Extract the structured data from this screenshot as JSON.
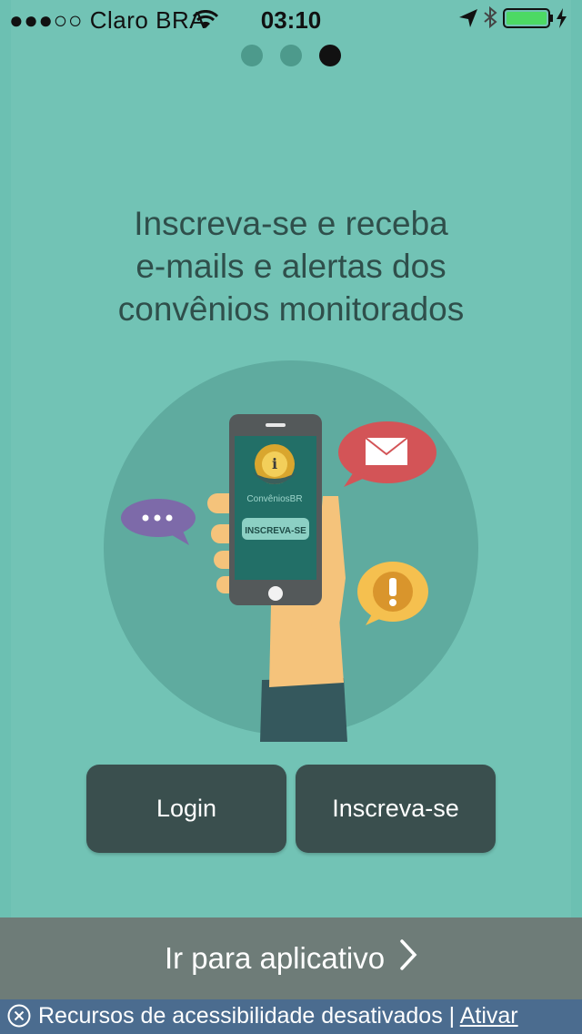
{
  "status_bar": {
    "carrier": "●●●○○ Claro BRA",
    "time": "03:10"
  },
  "pager": {
    "pages": 3,
    "current": 3
  },
  "headline": {
    "line1": "Inscreva-se e receba",
    "line2": "e-mails e alertas dos",
    "line3": "convênios monitorados"
  },
  "illustration": {
    "app_name": "ConvêniosBR",
    "phone_button": "INSCREVA-SE"
  },
  "buttons": {
    "login": "Login",
    "signup": "Inscreva-se"
  },
  "go_bar": {
    "label": "Ir para aplicativo"
  },
  "accessibility": {
    "text": "Recursos de acessibilidade desativados | ",
    "link": "Ativar"
  },
  "colors": {
    "background": "#72c3b5",
    "button": "#3a4f4e",
    "go_bar": "#6e7c78",
    "accessibility_bar": "#4b6c8f"
  }
}
